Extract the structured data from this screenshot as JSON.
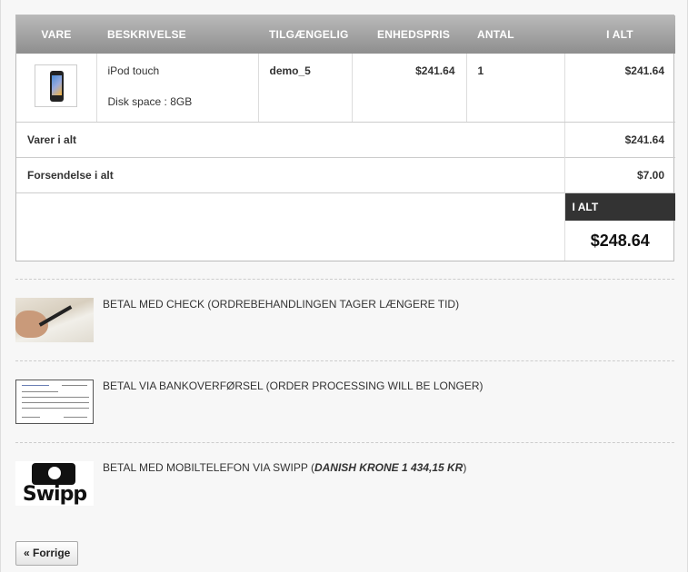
{
  "cart": {
    "headers": {
      "item": "VARE",
      "description": "BESKRIVELSE",
      "availability": "TILGÆNGELIG",
      "unit_price": "ENHEDSPRIS",
      "quantity": "ANTAL",
      "total": "I ALT"
    },
    "items": [
      {
        "name": "iPod touch",
        "attribute": "Disk space : 8GB",
        "availability": "demo_5",
        "unit_price": "$241.64",
        "quantity": "1",
        "total": "$241.64",
        "image_icon": "ipod-touch-thumbnail"
      }
    ],
    "subtotal_label": "Varer i alt",
    "subtotal_value": "$241.64",
    "shipping_label": "Forsendelse i alt",
    "shipping_value": "$7.00",
    "grand_label": "I ALT",
    "grand_value": "$248.64"
  },
  "payments": [
    {
      "label": "BETAL MED CHECK (ORDREBEHANDLINGEN TAGER LÆNGERE TID)",
      "icon": "check-payment-image"
    },
    {
      "label": "BETAL VIA BANKOVERFØRSEL (ORDER PROCESSING WILL BE LONGER)",
      "icon": "bank-transfer-image"
    },
    {
      "label": "BETAL MED MOBILTELEFON VIA SWIPP (",
      "amount": "DANISH KRONE 1 434,15 KR",
      "suffix": ")",
      "icon": "swipp-logo",
      "logo_text": "Swipp"
    }
  ],
  "nav": {
    "back_label": "« Forrige"
  }
}
